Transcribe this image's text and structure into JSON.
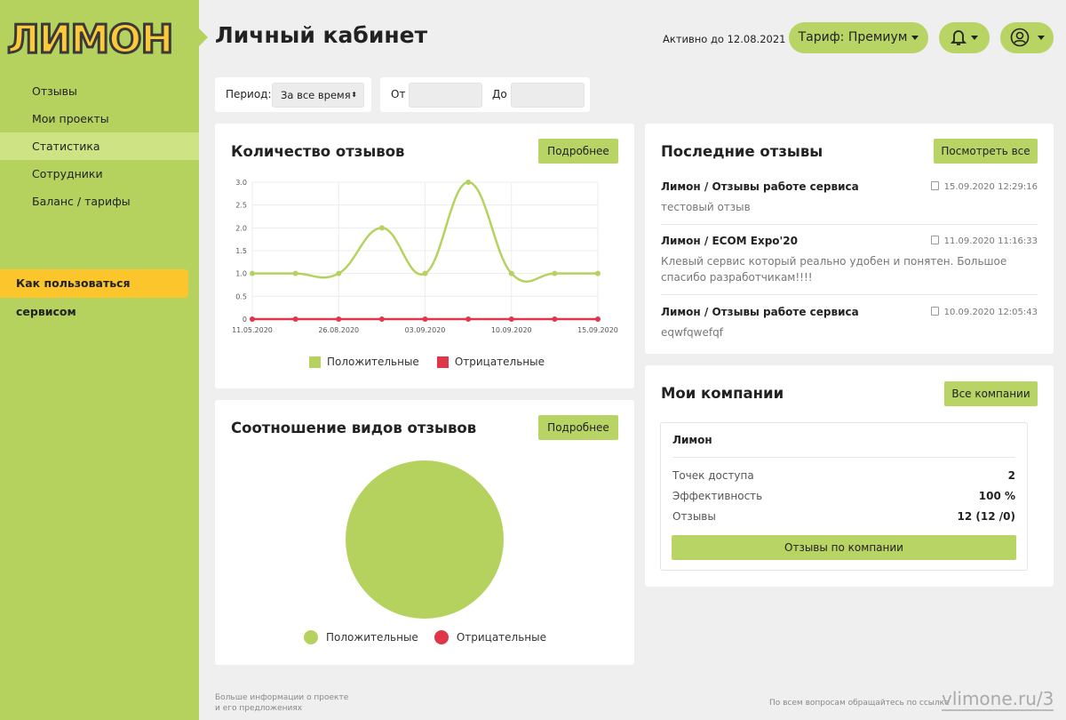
{
  "logo": "ЛИМОН",
  "sidebar": {
    "items": [
      {
        "label": "Отзывы"
      },
      {
        "label": "Мои проекты"
      },
      {
        "label": "Статистика",
        "active": true
      },
      {
        "label": "Сотрудники"
      },
      {
        "label": "Баланс / тарифы"
      }
    ],
    "help_button": "Как пользоваться сервисом"
  },
  "header": {
    "title": "Личный кабинет",
    "active_until": "Активно до 12.08.2021",
    "tariff": "Тариф: Премиум"
  },
  "filters": {
    "period_label": "Период:",
    "period_value": "За все время",
    "from_label": "От",
    "to_label": "До",
    "from_value": "",
    "to_value": ""
  },
  "reviews_chart": {
    "title": "Количество отзывов",
    "more": "Подробнее"
  },
  "ratio_chart": {
    "title": "Соотношение видов отзывов",
    "more": "Подробнее"
  },
  "chart_data": [
    {
      "type": "line",
      "title": "Количество отзывов",
      "x": [
        "11.05.2020",
        "",
        "26.08.2020",
        "",
        "03.09.2020",
        "",
        "10.09.2020",
        "",
        "15.09.2020"
      ],
      "series": [
        {
          "name": "Положительные",
          "color": "#b5d25f",
          "values": [
            1,
            1,
            1,
            2,
            1,
            3,
            1,
            1,
            1
          ]
        },
        {
          "name": "Отрицательные",
          "color": "#e0364a",
          "values": [
            0,
            0,
            0,
            0,
            0,
            0,
            0,
            0,
            0
          ]
        }
      ],
      "yticks": [
        "0",
        "0.5",
        "1.0",
        "1.5",
        "2.0",
        "2.5",
        "3.0"
      ],
      "ylim": [
        0,
        3
      ],
      "grid": true,
      "legend": "bottom"
    },
    {
      "type": "pie",
      "title": "Соотношение видов отзывов",
      "series": [
        {
          "name": "Положительные",
          "color": "#b5d25f",
          "value": 12
        },
        {
          "name": "Отрицательные",
          "color": "#e0364a",
          "value": 0
        }
      ],
      "legend": "bottom"
    }
  ],
  "latest": {
    "title": "Последние отзывы",
    "view_all": "Посмотреть все",
    "items": [
      {
        "source": "Лимон / Отзывы работе сервиса",
        "date": "15.09.2020 12:29:16",
        "text": "тестовый отзыв"
      },
      {
        "source": "Лимон / ECOM Expo'20",
        "date": "11.09.2020 11:16:33",
        "text": "Клевый сервис который реально удобен и понятен. Большое спасибо разработчикам!!!!"
      },
      {
        "source": "Лимон / Отзывы работе сервиса",
        "date": "10.09.2020 12:05:43",
        "text": "eqwfqwefqf"
      }
    ]
  },
  "companies": {
    "title": "Мои компании",
    "all": "Все компании",
    "company": {
      "name": "Лимон",
      "rows": [
        {
          "label": "Точек доступа",
          "value": "2"
        },
        {
          "label": "Эффективность",
          "value": "100 %"
        },
        {
          "label": "Отзывы",
          "value": "12 (12 /0)"
        }
      ],
      "button": "Отзывы по компании"
    }
  },
  "footer": {
    "left1": "Больше информации о проекте",
    "left2": "и его предложениях",
    "right": "По всем вопросам обращайтесь по ссылке",
    "link": "vlimone.ru/3"
  }
}
